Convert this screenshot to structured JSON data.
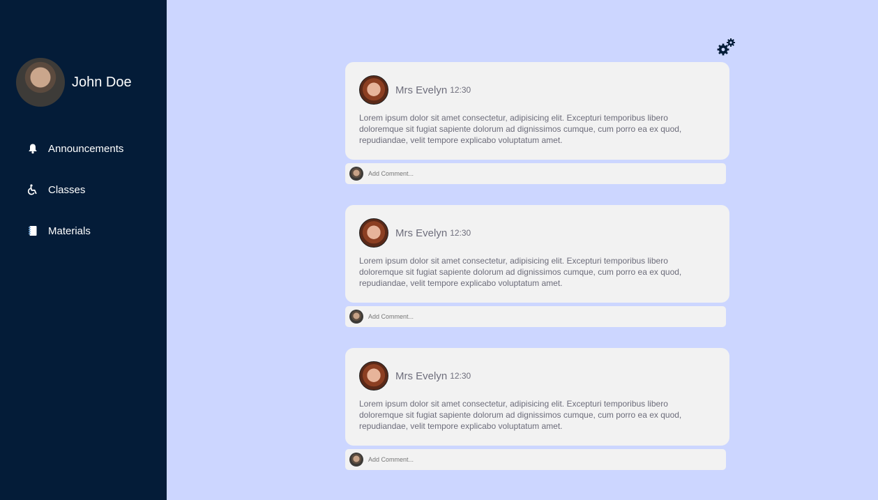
{
  "user": {
    "name": "John Doe"
  },
  "nav": {
    "items": [
      {
        "label": "Announcements",
        "icon": "bell-icon"
      },
      {
        "label": "Classes",
        "icon": "wheelchair-icon"
      },
      {
        "label": "Materials",
        "icon": "notebook-icon"
      }
    ]
  },
  "settings": {
    "icon": "gears-icon"
  },
  "posts": [
    {
      "author": "Mrs Evelyn",
      "time": "12:30",
      "body": "Lorem ipsum dolor sit amet consectetur, adipisicing elit. Excepturi temporibus libero doloremque sit fugiat sapiente dolorum ad dignissimos cumque, cum porro ea ex quod, repudiandae, velit tempore explicabo voluptatum amet.",
      "comment_placeholder": "Add Comment..."
    },
    {
      "author": "Mrs Evelyn",
      "time": "12:30",
      "body": "Lorem ipsum dolor sit amet consectetur, adipisicing elit. Excepturi temporibus libero doloremque sit fugiat sapiente dolorum ad dignissimos cumque, cum porro ea ex quod, repudiandae, velit tempore explicabo voluptatum amet.",
      "comment_placeholder": "Add Comment..."
    },
    {
      "author": "Mrs Evelyn",
      "time": "12:30",
      "body": "Lorem ipsum dolor sit amet consectetur, adipisicing elit. Excepturi temporibus libero doloremque sit fugiat sapiente dolorum ad dignissimos cumque, cum porro ea ex quod, repudiandae, velit tempore explicabo voluptatum amet.",
      "comment_placeholder": "Add Comment..."
    }
  ],
  "colors": {
    "sidebar": "#041c38",
    "background": "#ccd6ff",
    "card": "#f2f2f2"
  }
}
